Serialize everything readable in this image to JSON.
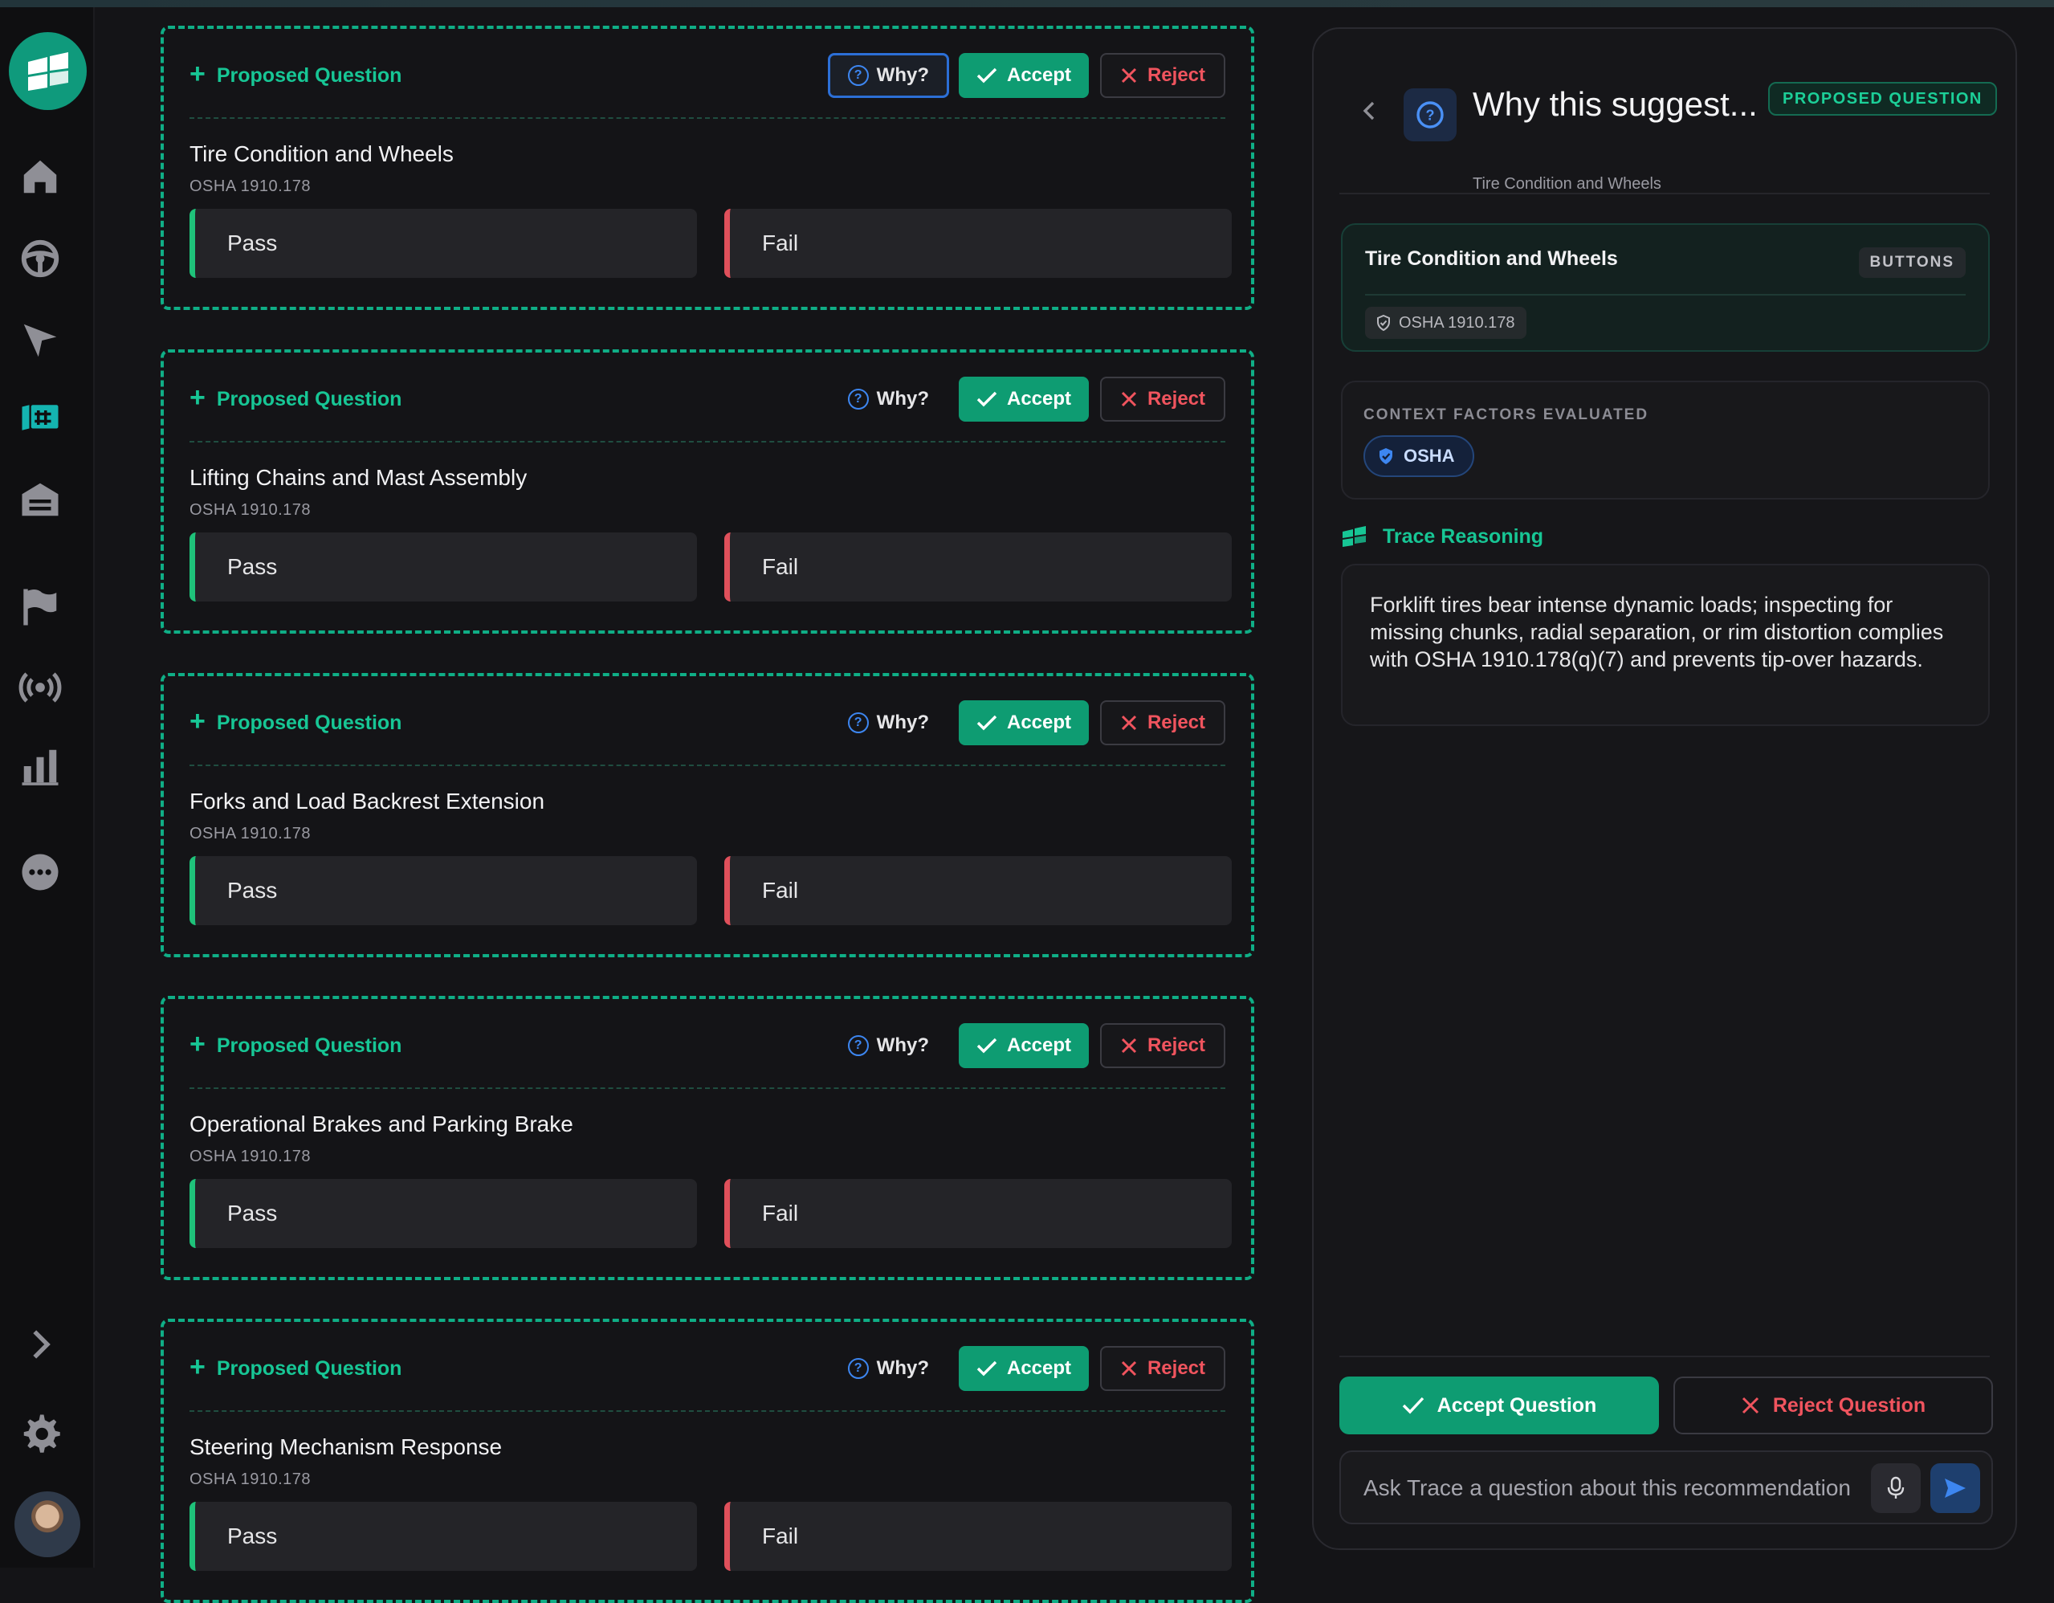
{
  "nav": {
    "items": [
      "home",
      "driver",
      "navigation",
      "inspections",
      "garage",
      "flag",
      "broadcast",
      "reports",
      "more"
    ],
    "expand": "expand",
    "settings": "settings"
  },
  "labels": {
    "proposed": "Proposed Question",
    "why": "Why?",
    "accept": "Accept",
    "reject": "Reject",
    "pass": "Pass",
    "fail": "Fail"
  },
  "questions": [
    {
      "title": "Tire Condition and Wheels",
      "ref": "OSHA 1910.178"
    },
    {
      "title": "Lifting Chains and Mast Assembly",
      "ref": "OSHA 1910.178"
    },
    {
      "title": "Forks and Load Backrest Extension",
      "ref": "OSHA 1910.178"
    },
    {
      "title": "Operational Brakes and Parking Brake",
      "ref": "OSHA 1910.178"
    },
    {
      "title": "Steering Mechanism Response",
      "ref": "OSHA 1910.178"
    }
  ],
  "panel": {
    "title": "Why this suggest...",
    "badge": "PROPOSED QUESTION",
    "subtitle": "Tire Condition and Wheels",
    "summary": {
      "title": "Tire Condition and Wheels",
      "type": "BUTTONS",
      "ref": "OSHA 1910.178"
    },
    "context": {
      "label": "CONTEXT FACTORS EVALUATED",
      "chip": "OSHA"
    },
    "reasoning": {
      "heading": "Trace Reasoning",
      "text": "Forklift tires bear intense dynamic loads; inspecting for missing chunks, radial separation, or rim distortion complies with OSHA 1910.178(q)(7) and prevents tip-over hazards."
    },
    "accept_question": "Accept Question",
    "reject_question": "Reject Question",
    "ask_placeholder": "Ask Trace a question about this recommendation"
  },
  "colors": {
    "accent_green": "#0e9c72",
    "proposed_green": "#17c695",
    "reject_red": "#f0545e",
    "pass_bar": "#1fc27a",
    "fail_bar": "#e0505b",
    "info_blue": "#3d86f0"
  }
}
